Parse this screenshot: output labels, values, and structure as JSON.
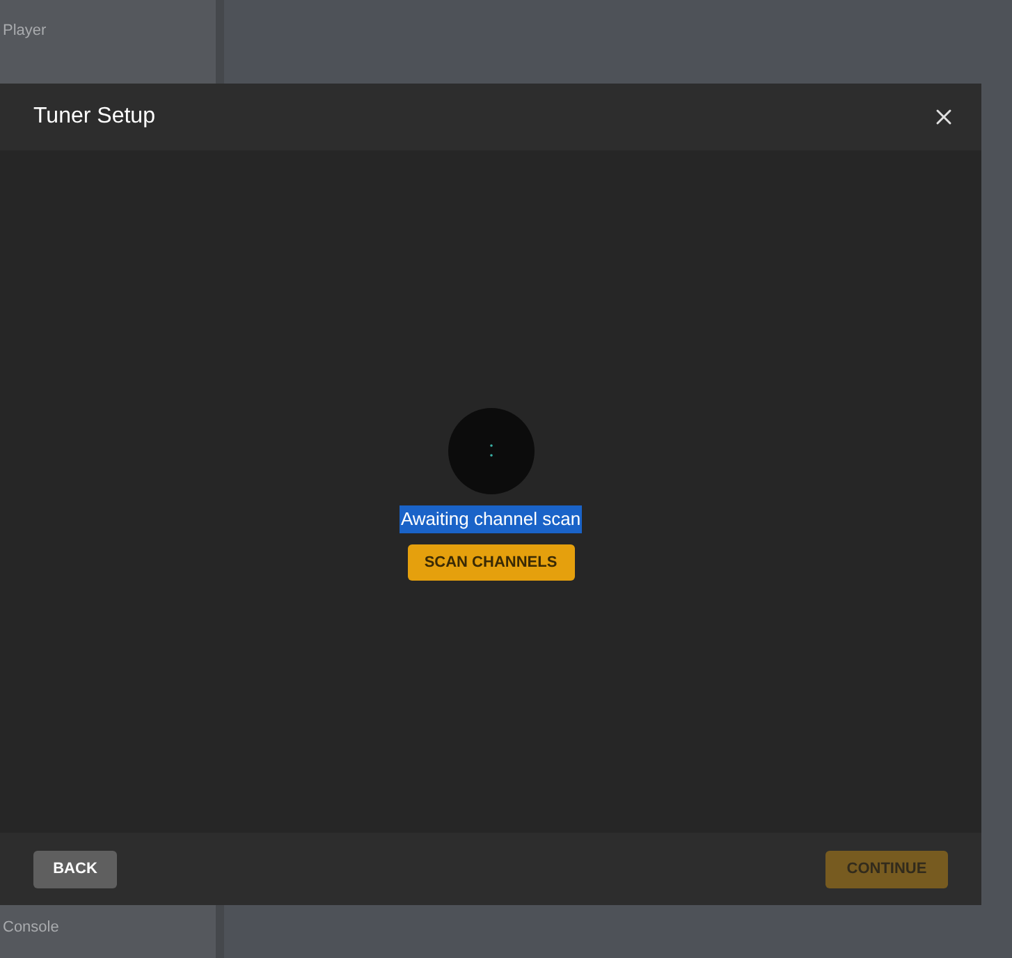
{
  "sidebar": {
    "items": [
      {
        "label": "Player"
      },
      {
        "label": "Console"
      }
    ]
  },
  "dialog": {
    "title": "Tuner Setup",
    "status": {
      "text": "Awaiting channel scan",
      "selected": true
    },
    "scan_button": {
      "label": "SCAN CHANNELS"
    },
    "footer_buttons": [
      {
        "label": "BACK",
        "disabled": false,
        "kind": "secondary"
      },
      {
        "label": "CONTINUE",
        "disabled": true,
        "kind": "primary"
      }
    ]
  }
}
